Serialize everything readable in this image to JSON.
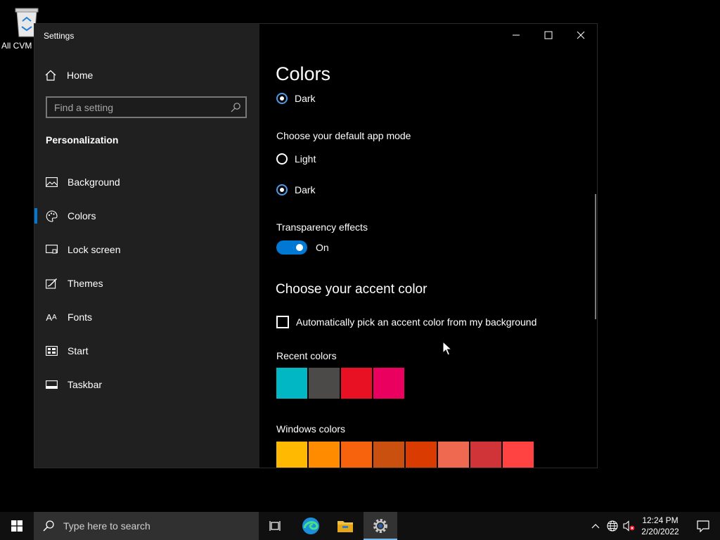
{
  "desktop": {
    "recycle_label": "All CVM Moderat"
  },
  "window": {
    "title": "Settings",
    "controls": {
      "minimize": "minimize-icon",
      "maximize": "maximize-icon",
      "close": "close-icon"
    }
  },
  "sidebar": {
    "home_label": "Home",
    "search_placeholder": "Find a setting",
    "section": "Personalization",
    "items": [
      {
        "label": "Background",
        "icon": "picture-icon"
      },
      {
        "label": "Colors",
        "icon": "palette-icon",
        "active": true
      },
      {
        "label": "Lock screen",
        "icon": "lock-screen-icon"
      },
      {
        "label": "Themes",
        "icon": "themes-icon"
      },
      {
        "label": "Fonts",
        "icon": "fonts-icon"
      },
      {
        "label": "Start",
        "icon": "start-icon"
      },
      {
        "label": "Taskbar",
        "icon": "taskbar-icon"
      }
    ]
  },
  "main": {
    "title": "Colors",
    "windows_mode_selected": "Dark",
    "app_mode": {
      "heading": "Choose your default app mode",
      "options": [
        "Light",
        "Dark"
      ],
      "selected": "Dark"
    },
    "transparency": {
      "heading": "Transparency effects",
      "state": "On"
    },
    "accent": {
      "heading": "Choose your accent color",
      "auto_pick_label": "Automatically pick an accent color from my background",
      "auto_pick_checked": false,
      "recent_heading": "Recent colors",
      "recent_colors": [
        "#00b7c3",
        "#4c4a48",
        "#e81123",
        "#ea005e"
      ],
      "windows_heading": "Windows colors",
      "windows_colors": [
        "#ffb900",
        "#ff8c00",
        "#f7630c",
        "#ca5010",
        "#da3b01",
        "#ef6950",
        "#d13438",
        "#ff4343"
      ]
    }
  },
  "taskbar": {
    "search_placeholder": "Type here to search",
    "time": "12:24 PM",
    "date": "2/20/2022",
    "accent": "#76b9ed"
  }
}
